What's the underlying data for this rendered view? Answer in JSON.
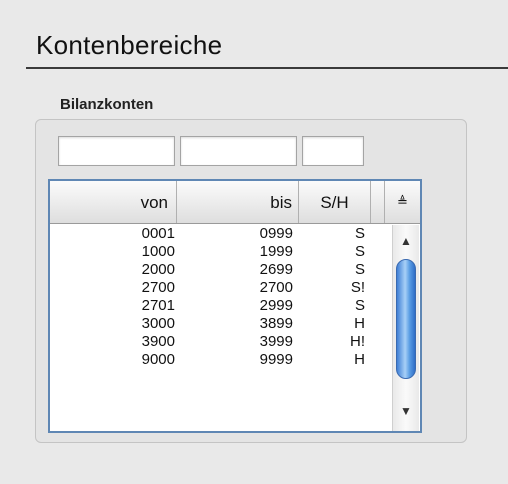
{
  "page": {
    "title": "Kontenbereiche"
  },
  "section": {
    "label": "Bilanzkonten"
  },
  "filters": {
    "von": "",
    "bis": "",
    "sh": ""
  },
  "table": {
    "headers": {
      "von": "von",
      "bis": "bis",
      "sh": "S/H",
      "sort_icon": "≜"
    },
    "rows": [
      {
        "von": "0001",
        "bis": "0999",
        "sh": "S"
      },
      {
        "von": "1000",
        "bis": "1999",
        "sh": "S"
      },
      {
        "von": "2000",
        "bis": "2699",
        "sh": "S"
      },
      {
        "von": "2700",
        "bis": "2700",
        "sh": "S!"
      },
      {
        "von": "2701",
        "bis": "2999",
        "sh": "S"
      },
      {
        "von": "3000",
        "bis": "3899",
        "sh": "H"
      },
      {
        "von": "3900",
        "bis": "3999",
        "sh": "H!"
      },
      {
        "von": "9000",
        "bis": "9999",
        "sh": "H"
      }
    ]
  },
  "scrollbar": {
    "up_icon": "▲",
    "down_icon": "▼"
  },
  "colors": {
    "focus_border": "#5f87b4",
    "thumb": "#4a8de0",
    "title_rule": "#3a3a3a"
  }
}
